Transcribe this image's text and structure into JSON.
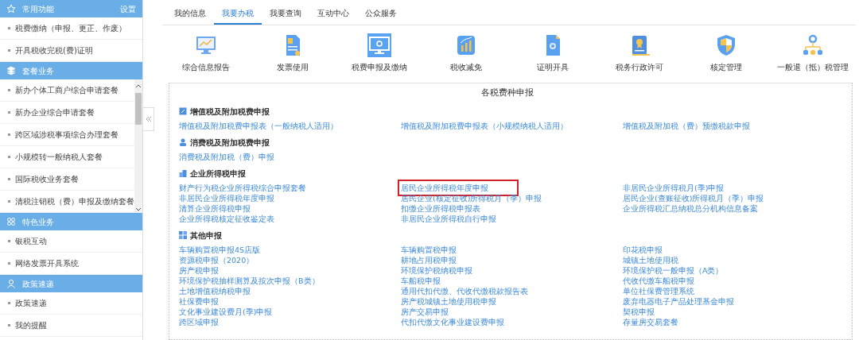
{
  "sidebar": {
    "settings": "设置",
    "sections": [
      {
        "title": "常用功能",
        "items": [
          {
            "label": "税费缴纳（申报、更正、作废）"
          },
          {
            "label": "开具税收完税(费)证明"
          }
        ]
      },
      {
        "title": "套餐业务",
        "items": [
          {
            "label": "新办个体工商户综合申请套餐"
          },
          {
            "label": "新办企业综合申请套餐"
          },
          {
            "label": "跨区域涉税事项综合办理套餐"
          },
          {
            "label": "小规模转一般纳税人套餐"
          },
          {
            "label": "国际税收业务套餐"
          },
          {
            "label": "清税注销税（费）申报及缴纳套餐"
          }
        ]
      },
      {
        "title": "特色业务",
        "items": [
          {
            "label": "银税互动"
          },
          {
            "label": "网络发票开具系统"
          }
        ]
      },
      {
        "title": "政策速递",
        "items": [
          {
            "label": "政策速递"
          },
          {
            "label": "我的提醒"
          }
        ]
      }
    ]
  },
  "tabs": [
    {
      "label": "我的信息",
      "selected": false
    },
    {
      "label": "我要办税",
      "selected": true
    },
    {
      "label": "我要查询",
      "selected": false
    },
    {
      "label": "互动中心",
      "selected": false
    },
    {
      "label": "公众服务",
      "selected": false
    }
  ],
  "services": [
    {
      "label": "综合信息报告",
      "selected": false
    },
    {
      "label": "发票使用",
      "selected": false
    },
    {
      "label": "税费申报及缴纳",
      "selected": true
    },
    {
      "label": "税收减免",
      "selected": false
    },
    {
      "label": "证明开具",
      "selected": false
    },
    {
      "label": "税务行政许可",
      "selected": false
    },
    {
      "label": "核定管理",
      "selected": false
    },
    {
      "label": "一般退（抵）税管理",
      "selected": false
    }
  ],
  "panel": {
    "title": "各税费种申报",
    "groups": [
      {
        "title": "增值税及附加税费申报",
        "items": [
          {
            "label": "增值税及附加税费申报表（一般纳税人适用）",
            "highlighted": false
          },
          {
            "label": "增值税及附加税费申报表（小规模纳税人适用）",
            "highlighted": false
          },
          {
            "label": "增值税及附加税（费）预缴税款申报",
            "highlighted": false
          }
        ]
      },
      {
        "title": "消费税及附加税费申报",
        "items": [
          {
            "label": "消费税及附加税（费）申报",
            "highlighted": false
          }
        ]
      },
      {
        "title": "企业所得税申报",
        "items": [
          {
            "label": "财产行为税企业所得税综合申报套餐",
            "highlighted": false
          },
          {
            "label": "居民企业所得税年度申报",
            "highlighted": true
          },
          {
            "label": "非居民企业所得税月(季)申报",
            "highlighted": false
          },
          {
            "label": "非居民企业所得税年度申报",
            "highlighted": false
          },
          {
            "label": "居民企业(核定征收)所得税月（季）申报",
            "highlighted": false
          },
          {
            "label": "居民企业(查账征收)所得税月（季）申报",
            "highlighted": false
          },
          {
            "label": "清算企业所得税申报",
            "highlighted": false
          },
          {
            "label": "扣缴企业所得税申报表",
            "highlighted": false
          },
          {
            "label": "企业所得税汇总纳税总分机构信息备案",
            "highlighted": false
          },
          {
            "label": "企业所得税核定征收鉴定表",
            "highlighted": false
          },
          {
            "label": "非居民企业所得税自行申报",
            "highlighted": false
          }
        ]
      },
      {
        "title": "其他申报",
        "items": [
          {
            "label": "车辆购置税申报4S店版",
            "highlighted": false
          },
          {
            "label": "车辆购置税申报",
            "highlighted": false
          },
          {
            "label": "印花税申报",
            "highlighted": false
          },
          {
            "label": "资源税申报（2020）",
            "highlighted": false
          },
          {
            "label": "耕地占用税申报",
            "highlighted": false
          },
          {
            "label": "城镇土地使用税",
            "highlighted": false
          },
          {
            "label": "房产税申报",
            "highlighted": false
          },
          {
            "label": "环境保护税纳税申报",
            "highlighted": false
          },
          {
            "label": "环境保护税一般申报（A类）",
            "highlighted": false
          },
          {
            "label": "环境保护税抽样测算及按次申报（B类）",
            "highlighted": false
          },
          {
            "label": "车船税申报",
            "highlighted": false
          },
          {
            "label": "代收代缴车船税申报",
            "highlighted": false
          },
          {
            "label": "土地增值税纳税申报",
            "highlighted": false
          },
          {
            "label": "通用代扣代缴、代收代缴税款报告表",
            "highlighted": false
          },
          {
            "label": "单位社保费管理系统",
            "highlighted": false
          },
          {
            "label": "社保费申报",
            "highlighted": false
          },
          {
            "label": "房产税城镇土地使用税申报",
            "highlighted": false
          },
          {
            "label": "废弃电器电子产品处理基金申报",
            "highlighted": false
          },
          {
            "label": "文化事业建设费月(季)申报",
            "highlighted": false
          },
          {
            "label": "房产交易申报",
            "highlighted": false
          },
          {
            "label": "契税申报",
            "highlighted": false
          },
          {
            "label": "跨区域申报",
            "highlighted": false
          },
          {
            "label": "代扣代缴文化事业建设费申报",
            "highlighted": false
          },
          {
            "label": "存量房交易套餐",
            "highlighted": false
          }
        ]
      }
    ]
  }
}
